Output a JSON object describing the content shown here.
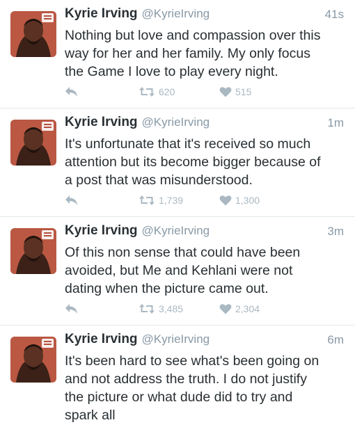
{
  "tweets": [
    {
      "name": "Kyrie Irving",
      "handle": "@KyrieIrving",
      "time": "41s",
      "text": "Nothing but love and compassion over this\nway for her and her family. My only focus\nthe Game I love to play every night.",
      "retweets": "620",
      "likes": "515"
    },
    {
      "name": "Kyrie Irving",
      "handle": "@KyrieIrving",
      "time": "1m",
      "text": "It's unfortunate that it's received so much\nattention but its become bigger because of\na post that was misunderstood.",
      "retweets": "1,739",
      "likes": "1,300"
    },
    {
      "name": "Kyrie Irving",
      "handle": "@KyrieIrving",
      "time": "3m",
      "text": "Of this non sense that could have been\navoided, but Me and Kehlani were not\ndating when the picture came out.",
      "retweets": "3,485",
      "likes": "2,304"
    },
    {
      "name": "Kyrie Irving",
      "handle": "@KyrieIrving",
      "time": "6m",
      "text": "It's been hard to see what's been going on\nand not address the truth. I do not justify\nthe picture or what dude did to try and\nspark all",
      "retweets": "",
      "likes": ""
    }
  ],
  "colors": {
    "text": "#292f33",
    "meta": "#8899a6",
    "icon": "#aab8c2",
    "avatar_bg": "#b3503d"
  }
}
